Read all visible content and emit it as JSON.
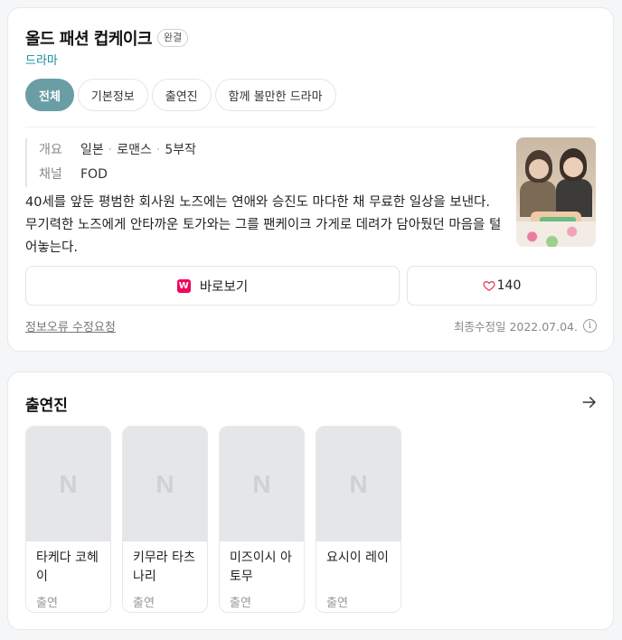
{
  "header": {
    "title": "올드 패션 컵케이크",
    "status_badge": "완결",
    "genre": "드라마"
  },
  "tabs": [
    {
      "label": "전체",
      "active": true
    },
    {
      "label": "기본정보",
      "active": false
    },
    {
      "label": "출연진",
      "active": false
    },
    {
      "label": "함께 볼만한 드라마",
      "active": false
    }
  ],
  "meta": {
    "overview_label": "개요",
    "overview_items": [
      "일본",
      "로맨스",
      "5부작"
    ],
    "channel_label": "채널",
    "channel_value": "FOD"
  },
  "description": "40세를 앞둔 평범한 회사원 노즈에는 연애와 승진도 마다한 채 무료한 일상을 보낸다. 무기력한 노즈에게 안타까운 토가와는 그를 팬케이크 가게로 데려가 담아뒀던 마음을 털어놓는다.",
  "poster": {
    "icon": "drama-poster-image"
  },
  "actions": {
    "watch_label": "바로보기",
    "watch_icon_glyph": "W",
    "watch_icon_color": "#f0065a",
    "like_count": "140"
  },
  "footer": {
    "report_label": "정보오류 수정요청",
    "updated_label": "최종수정일 2022.07.04.",
    "info_icon_glyph": "i"
  },
  "cast_section": {
    "title": "출연진",
    "members": [
      {
        "name": "타케다 코헤이",
        "role": "출연",
        "placeholder": "N"
      },
      {
        "name": "키무라 타츠나리",
        "role": "출연",
        "placeholder": "N"
      },
      {
        "name": "미즈이시 아토무",
        "role": "출연",
        "placeholder": "N"
      },
      {
        "name": "요시이 레이",
        "role": "출연",
        "placeholder": "N"
      }
    ]
  },
  "colors": {
    "accent": "#6a9ea4",
    "genre_link": "#10909c",
    "heart": "#e0344b"
  }
}
